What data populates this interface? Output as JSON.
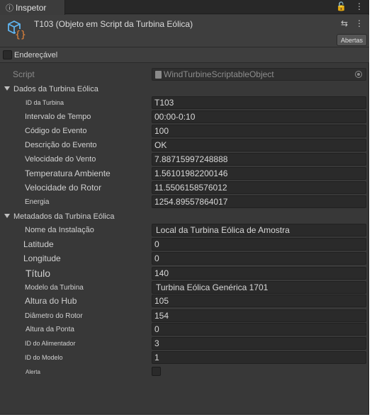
{
  "tab": {
    "icon": "info-icon",
    "label": "Inspetor"
  },
  "tab_tools": {
    "lock": "lock-icon",
    "menu": "more-vertical-icon"
  },
  "header": {
    "title": "T103 (Objeto em Script da Turbina Eólica)",
    "open_button": "Abertas",
    "icons": [
      "scriptable-object-icon",
      "adjust-icon",
      "more-vertical-icon"
    ]
  },
  "addressable": {
    "label": "Endereçável",
    "checked": false
  },
  "script": {
    "label": "Script",
    "value": "WindTurbineScriptableObject"
  },
  "section1": {
    "label": "Dados da Turbina Eólica",
    "fields": [
      {
        "label": "ID da Turbina",
        "value": "T103"
      },
      {
        "label": "Intervalo de Tempo",
        "value": "00:00-0:10"
      },
      {
        "label": "Código do Evento",
        "value": "100"
      },
      {
        "label": "Descrição do Evento",
        "value": "OK"
      },
      {
        "label": "Velocidade do Vento",
        "value": "7.88715997248888"
      },
      {
        "label": "Temperatura Ambiente",
        "value": "1.56101982200146"
      },
      {
        "label": "Velocidade do Rotor",
        "value": "11.5506158576012"
      },
      {
        "label": "Energia",
        "value": "1254.89557864017"
      }
    ]
  },
  "section2": {
    "label": "Metadados da Turbina Eólica",
    "fields": [
      {
        "label": "Nome da Instalação",
        "value": "Local da Turbina Eólica de Amostra"
      },
      {
        "label": "Latitude",
        "value": "0"
      },
      {
        "label": "Longitude",
        "value": "0"
      },
      {
        "label": "Título",
        "value": "140"
      },
      {
        "label": "Modelo da Turbina",
        "value": "Turbina Eólica Genérica 1701"
      },
      {
        "label": "Altura do Hub",
        "value": "105"
      },
      {
        "label": "Diâmetro do Rotor",
        "value": "154"
      },
      {
        "label": "Altura da Ponta",
        "value": "0"
      },
      {
        "label": "ID do Alimentador",
        "value": "3"
      },
      {
        "label": "ID do Modelo",
        "value": "1"
      },
      {
        "label": "Alerta",
        "value": false
      }
    ]
  }
}
